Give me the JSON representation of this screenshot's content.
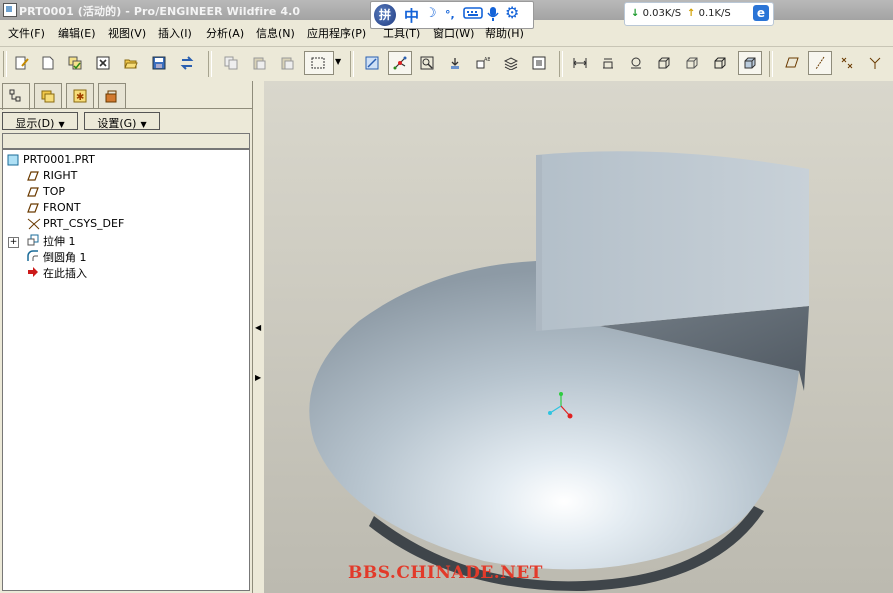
{
  "window": {
    "title": "PRT0001 (活动的) - Pro/ENGINEER Wildfire 4.0"
  },
  "ime": {
    "logo": "拼",
    "lang": "中",
    "icons": [
      "moon-icon",
      "punctuation-icon",
      "keyboard-icon",
      "microphone-icon",
      "gear-icon"
    ]
  },
  "network": {
    "down": "0.03K/S",
    "up": "0.1K/S",
    "browser": "e"
  },
  "menu": [
    {
      "label": "文件(F)"
    },
    {
      "label": "编辑(E)"
    },
    {
      "label": "视图(V)"
    },
    {
      "label": "插入(I)"
    },
    {
      "label": "分析(A)"
    },
    {
      "label": "信息(N)"
    },
    {
      "label": "应用程序(P)"
    },
    {
      "label": "工具(T)"
    },
    {
      "label": "窗口(W)"
    },
    {
      "label": "帮助(H)"
    }
  ],
  "panel": {
    "show_label": "显示(D)",
    "settings_label": "设置(G)",
    "tree": [
      {
        "label": "PRT0001.PRT",
        "icon": "part-icon"
      },
      {
        "label": "RIGHT",
        "icon": "datum-plane-icon"
      },
      {
        "label": "TOP",
        "icon": "datum-plane-icon"
      },
      {
        "label": "FRONT",
        "icon": "datum-plane-icon"
      },
      {
        "label": "PRT_CSYS_DEF",
        "icon": "coordinate-system-icon"
      },
      {
        "label": "拉伸 1",
        "icon": "extrude-icon"
      },
      {
        "label": "倒圆角 1",
        "icon": "round-icon"
      },
      {
        "label": "在此插入",
        "icon": "insert-here-arrow-icon"
      }
    ]
  },
  "colors": {
    "model_light": "#dfe6ec",
    "model_mid": "#a9b6c1",
    "model_dark": "#5d6670",
    "watermark": "#e23a2a"
  },
  "watermark": "BBS.CHINADE.NET"
}
